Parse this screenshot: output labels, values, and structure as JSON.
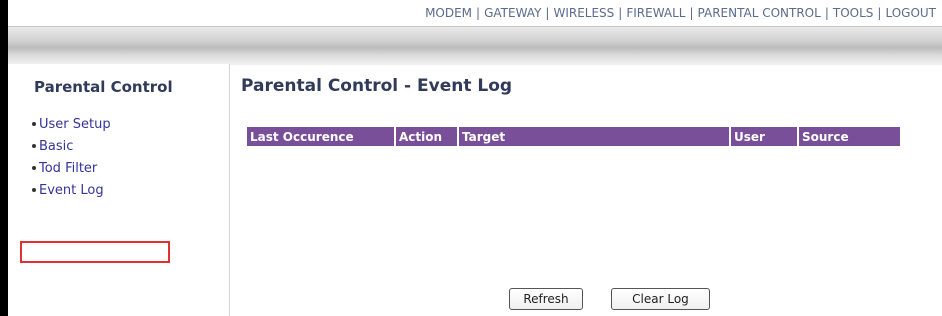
{
  "topnav": {
    "items": [
      "MODEM",
      "GATEWAY",
      "WIRELESS",
      "FIREWALL",
      "PARENTAL CONTROL",
      "TOOLS",
      "LOGOUT"
    ],
    "separator": "|"
  },
  "sidebar": {
    "title": "Parental Control",
    "items": [
      "User Setup",
      "Basic",
      "Tod Filter",
      "Event Log"
    ],
    "highlighted_item": "Event Log",
    "highlight_color": "#e03030"
  },
  "main": {
    "title": "Parental Control - Event Log",
    "table": {
      "headers": [
        "Last Occurence",
        "Action",
        "Target",
        "User",
        "Source"
      ],
      "rows": [],
      "header_color": "#7a4f9a"
    },
    "buttons": {
      "refresh": "Refresh",
      "clear_log": "Clear Log"
    }
  }
}
